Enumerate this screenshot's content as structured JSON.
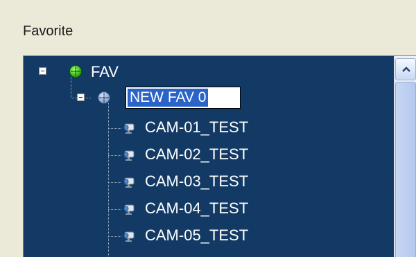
{
  "panel": {
    "title": "Favorite"
  },
  "tree": {
    "root": {
      "label": "FAV",
      "icon": "globe-green-icon",
      "expanded": true
    },
    "group": {
      "label": "NEW FAV 0",
      "icon": "globe-blue-icon",
      "expanded": true,
      "editing": true
    },
    "cameras": [
      {
        "label": "CAM-01_TEST",
        "icon": "camera-icon"
      },
      {
        "label": "CAM-02_TEST",
        "icon": "camera-icon"
      },
      {
        "label": "CAM-03_TEST",
        "icon": "camera-icon"
      },
      {
        "label": "CAM-04_TEST",
        "icon": "camera-icon"
      },
      {
        "label": "CAM-05_TEST",
        "icon": "camera-icon"
      }
    ]
  },
  "colors": {
    "tree_background": "#123a64",
    "selection": "#2a64c8",
    "window_background": "#ebe9d8"
  }
}
